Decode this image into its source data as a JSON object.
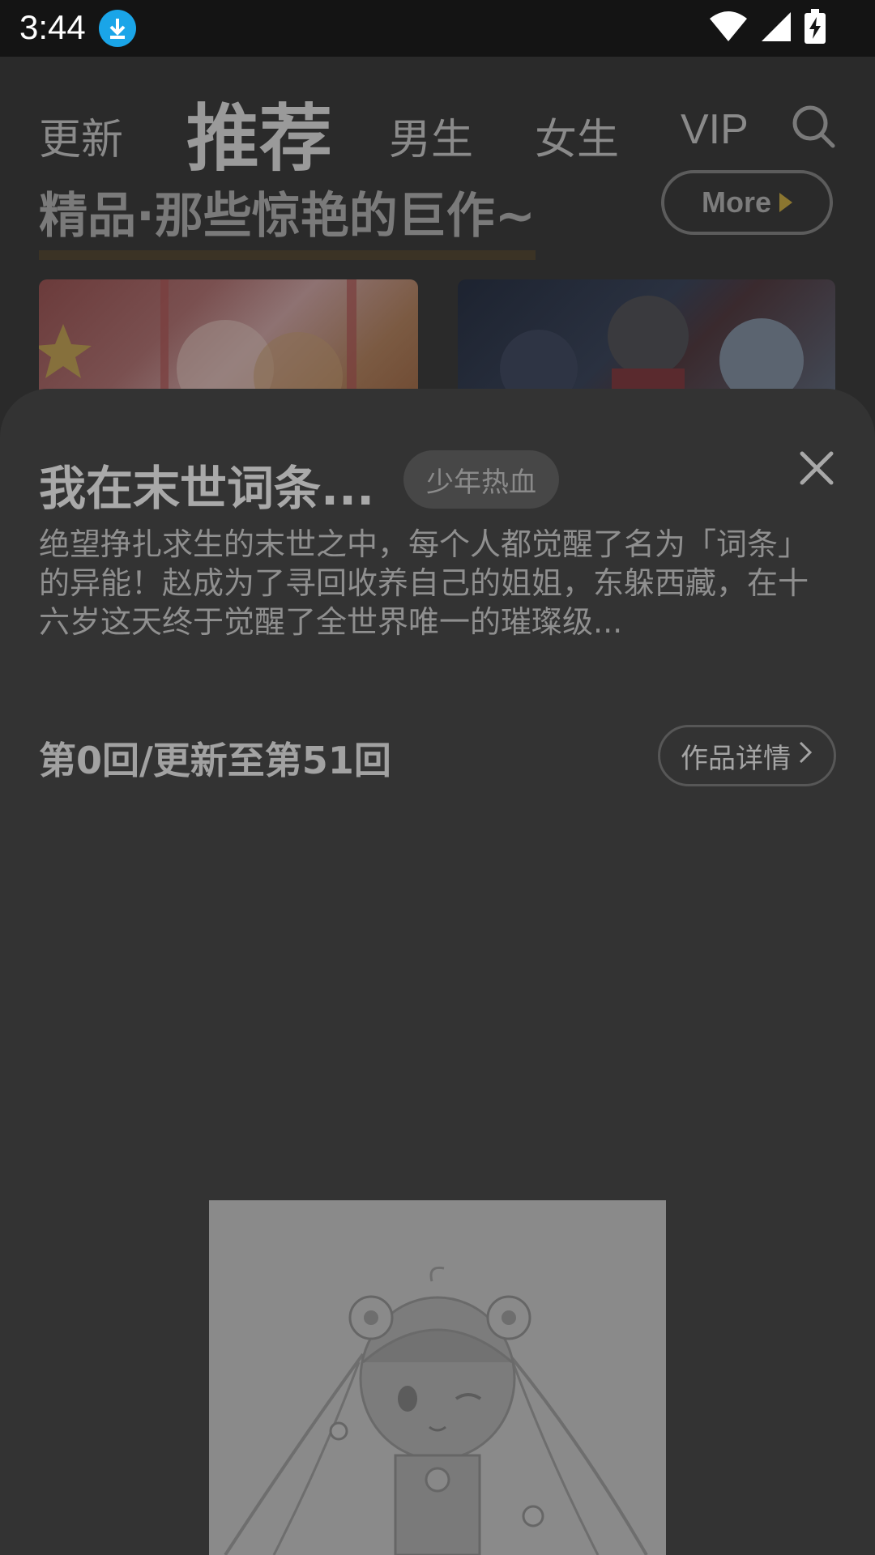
{
  "status_bar": {
    "time": "3:44",
    "icons": [
      "download-icon",
      "wifi-icon",
      "signal-icon",
      "battery-charging-icon"
    ]
  },
  "tabs": {
    "items": [
      {
        "label": "更新",
        "active": false
      },
      {
        "label": "推荐",
        "active": true
      },
      {
        "label": "男生",
        "active": false
      },
      {
        "label": "女生",
        "active": false
      },
      {
        "label": "VIP",
        "active": false
      }
    ],
    "search_icon": "search-icon"
  },
  "section": {
    "title": "精品·那些惊艳的巨作~",
    "more_label": "More"
  },
  "sheet": {
    "title": "我在末世词条...",
    "genre": "少年热血",
    "description": "绝望挣扎求生的末世之中，每个人都觉醒了名为「词条」的异能！赵成为了寻回收养自己的姐姐，东躲西藏，在十六岁这天终于觉醒了全世界唯一的璀璨级...",
    "episode_info": "第0回/更新至第51回",
    "detail_label": "作品详情",
    "close_icon": "close-icon"
  },
  "colors": {
    "accent_download": "#1aa5e8",
    "sheet_background": "#333333",
    "more_arrow": "#8b7630"
  }
}
